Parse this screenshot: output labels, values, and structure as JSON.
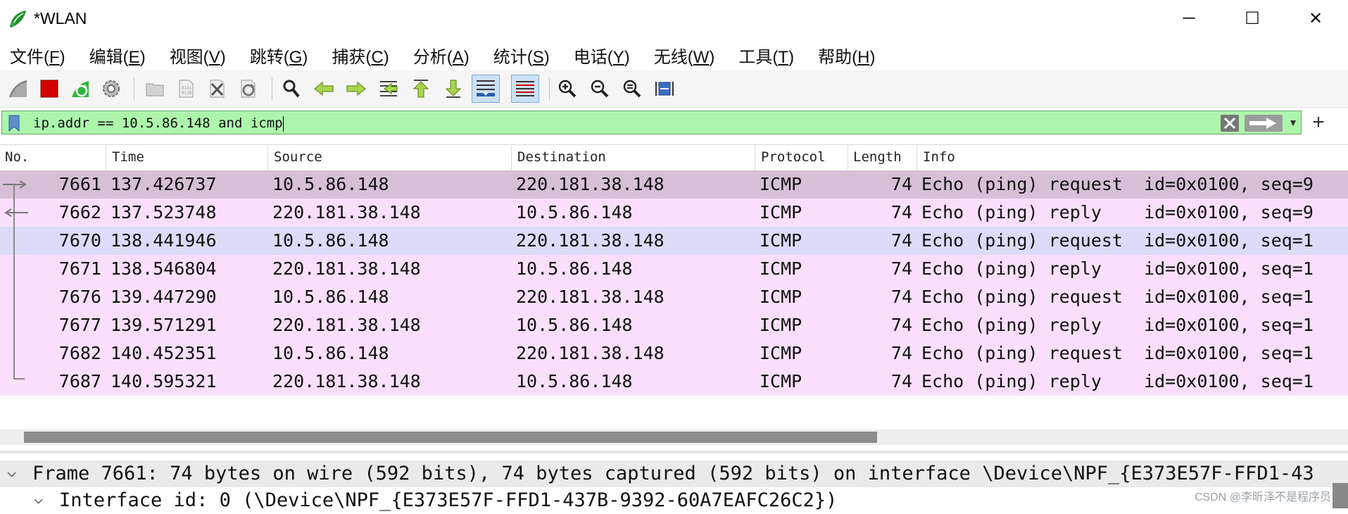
{
  "window": {
    "title": "*WLAN",
    "minimize_glyph": "─",
    "maximize_glyph": "☐",
    "close_glyph": "✕"
  },
  "menu": [
    {
      "text": "文件(",
      "key": "F",
      "end": ")"
    },
    {
      "text": "编辑(",
      "key": "E",
      "end": ")"
    },
    {
      "text": "视图(",
      "key": "V",
      "end": ")"
    },
    {
      "text": "跳转(",
      "key": "G",
      "end": ")"
    },
    {
      "text": "捕获(",
      "key": "C",
      "end": ")"
    },
    {
      "text": "分析(",
      "key": "A",
      "end": ")"
    },
    {
      "text": "统计(",
      "key": "S",
      "end": ")"
    },
    {
      "text": "电话(",
      "key": "Y",
      "end": ")"
    },
    {
      "text": "无线(",
      "key": "W",
      "end": ")"
    },
    {
      "text": "工具(",
      "key": "T",
      "end": ")"
    },
    {
      "text": "帮助(",
      "key": "H",
      "end": ")"
    }
  ],
  "toolbar": {
    "icons": [
      "shark-fin-start-icon",
      "stop-capture-icon",
      "restart-capture-icon",
      "capture-options-icon",
      "open-file-icon",
      "save-file-icon",
      "close-file-icon",
      "reload-file-icon",
      "find-packet-icon",
      "go-back-icon",
      "go-forward-icon",
      "go-to-packet-icon",
      "first-packet-icon",
      "last-packet-icon",
      "auto-scroll-icon",
      "colorize-icon",
      "zoom-in-icon",
      "zoom-out-icon",
      "normal-size-icon",
      "resize-columns-icon"
    ]
  },
  "filter": {
    "value": "ip.addr == 10.5.86.148 and icmp",
    "color": "#aef5ac"
  },
  "columns": [
    "No.",
    "Time",
    "Source",
    "Destination",
    "Protocol",
    "Length",
    "Info"
  ],
  "packets": [
    {
      "no": "7661",
      "time": "137.426737",
      "src": "10.5.86.148",
      "dst": "220.181.38.148",
      "proto": "ICMP",
      "len": "74",
      "info": "Echo (ping) request  id=0x0100, seq=9",
      "bg": "#d8bfd8"
    },
    {
      "no": "7662",
      "time": "137.523748",
      "src": "220.181.38.148",
      "dst": "10.5.86.148",
      "proto": "ICMP",
      "len": "74",
      "info": "Echo (ping) reply    id=0x0100, seq=9",
      "bg": "#f9dffb"
    },
    {
      "no": "7670",
      "time": "138.441946",
      "src": "10.5.86.148",
      "dst": "220.181.38.148",
      "proto": "ICMP",
      "len": "74",
      "info": "Echo (ping) request  id=0x0100, seq=1",
      "bg": "#dcdbf8"
    },
    {
      "no": "7671",
      "time": "138.546804",
      "src": "220.181.38.148",
      "dst": "10.5.86.148",
      "proto": "ICMP",
      "len": "74",
      "info": "Echo (ping) reply    id=0x0100, seq=1",
      "bg": "#f9dffb"
    },
    {
      "no": "7676",
      "time": "139.447290",
      "src": "10.5.86.148",
      "dst": "220.181.38.148",
      "proto": "ICMP",
      "len": "74",
      "info": "Echo (ping) request  id=0x0100, seq=1",
      "bg": "#f9dffb"
    },
    {
      "no": "7677",
      "time": "139.571291",
      "src": "220.181.38.148",
      "dst": "10.5.86.148",
      "proto": "ICMP",
      "len": "74",
      "info": "Echo (ping) reply    id=0x0100, seq=1",
      "bg": "#f9dffb"
    },
    {
      "no": "7682",
      "time": "140.452351",
      "src": "10.5.86.148",
      "dst": "220.181.38.148",
      "proto": "ICMP",
      "len": "74",
      "info": "Echo (ping) request  id=0x0100, seq=1",
      "bg": "#f9dffb"
    },
    {
      "no": "7687",
      "time": "140.595321",
      "src": "220.181.38.148",
      "dst": "10.5.86.148",
      "proto": "ICMP",
      "len": "74",
      "info": "Echo (ping) reply    id=0x0100, seq=1",
      "bg": "#f9dffb"
    }
  ],
  "details": {
    "frame_chevron": "⌵",
    "frame": "Frame 7661: 74 bytes on wire (592 bits), 74 bytes captured (592 bits) on interface \\Device\\NPF_{E373E57F-FFD1-43",
    "interface_chevron": "⌵",
    "interface": "Interface id: 0 (\\Device\\NPF_{E373E57F-FFD1-437B-9392-60A7EAFC26C2})"
  },
  "watermark": "CSDN @李昕泽不是程序员"
}
